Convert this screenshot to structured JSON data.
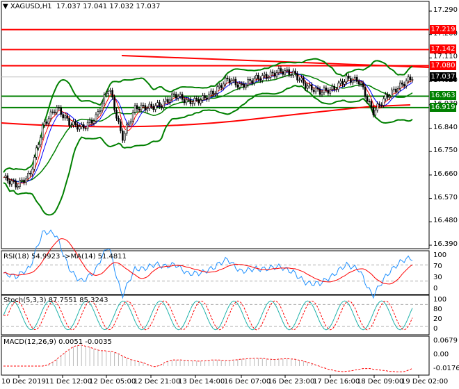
{
  "header": {
    "symbol": "XAGUSD,H1",
    "open": "17.037",
    "high": "17.041",
    "low": "17.032",
    "close": "17.037"
  },
  "colors": {
    "resistance": "#ff0000",
    "support": "#008000",
    "bull": "#008000",
    "bear": "#000000",
    "ma_blue": "#0000ff",
    "rsi": "#1e90ff",
    "stoch": "#20b2aa"
  },
  "price_tags": [
    {
      "value": "17.219",
      "color": "#ff0000"
    },
    {
      "value": "17.142",
      "color": "#ff0000"
    },
    {
      "value": "17.080",
      "color": "#ff0000"
    },
    {
      "value": "17.037",
      "color": "#000000"
    },
    {
      "value": "16.963",
      "color": "#008000"
    },
    {
      "value": "16.919",
      "color": "#008000"
    }
  ],
  "rsi": {
    "label": "RSI(18) 54.9923  ->MA(14) 51.4811",
    "ticks": [
      "100",
      "70",
      "30",
      "0"
    ]
  },
  "stoch": {
    "label": "Stoch(5,3,3) 87.7551 85.3243",
    "ticks": [
      "100",
      "80",
      "20",
      "0"
    ]
  },
  "macd": {
    "label": "MACD(12,26,9) 0.0051 -0.0035",
    "ticks": [
      "0.0679",
      "0.00",
      "-0.0176"
    ]
  },
  "chart_data": {
    "type": "line",
    "title": "XAGUSD,H1",
    "ylim": [
      16.39,
      17.29
    ],
    "y_ticks": [
      "17.290",
      "17.200",
      "17.110",
      "17.020",
      "16.930",
      "16.840",
      "16.750",
      "16.660",
      "16.570",
      "16.480",
      "16.390"
    ],
    "x_ticks": [
      "10 Dec 2019",
      "11 Dec 12:00",
      "12 Dec 05:00",
      "12 Dec 21:00",
      "13 Dec 14:00",
      "16 Dec 07:00",
      "16 Dec 23:00",
      "17 Dec 16:00",
      "18 Dec 09:00",
      "19 Dec 02:00"
    ],
    "close_path": [
      16.65,
      16.62,
      16.66,
      16.85,
      16.92,
      16.86,
      16.84,
      16.88,
      17.0,
      16.8,
      16.92,
      16.92,
      16.93,
      16.97,
      16.94,
      16.95,
      16.98,
      17.03,
      17.0,
      17.03,
      17.04,
      17.06,
      17.05,
      17.0,
      16.98,
      16.99,
      17.03,
      17.02,
      16.9,
      16.96,
      17.0,
      17.037
    ],
    "levels": {
      "resistance": [
        17.219,
        17.142,
        17.08
      ],
      "support": [
        16.963,
        16.919
      ],
      "current": 17.037
    }
  }
}
